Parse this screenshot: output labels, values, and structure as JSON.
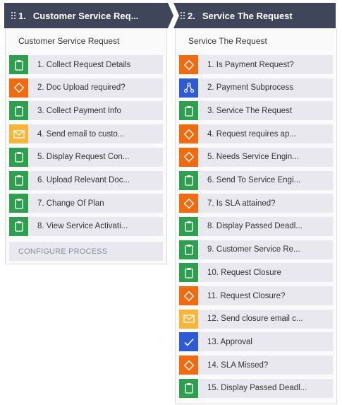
{
  "stages": [
    {
      "number": "1.",
      "header_title": "Customer Service Req...",
      "panel_title": "Customer Service Request",
      "configure_label": "CONFIGURE PROCESS",
      "steps": [
        {
          "label": "1.  Collect Request Details",
          "icon": "clipboard-icon",
          "color": "#2e9f4e"
        },
        {
          "label": "2.  Doc Upload required?",
          "icon": "diamond-icon",
          "color": "#f06a0f"
        },
        {
          "label": "3.  Collect Payment Info",
          "icon": "clipboard-icon",
          "color": "#2e9f4e"
        },
        {
          "label": "4.  Send email to custo...",
          "icon": "envelope-icon",
          "color": "#f7b53a"
        },
        {
          "label": "5.  Display Request Con...",
          "icon": "clipboard-icon",
          "color": "#2e9f4e"
        },
        {
          "label": "6.  Upload Relevant Doc...",
          "icon": "clipboard-icon",
          "color": "#2e9f4e"
        },
        {
          "label": "7.  Change Of Plan",
          "icon": "clipboard-icon",
          "color": "#2e9f4e"
        },
        {
          "label": "8.  View Service Activati...",
          "icon": "clipboard-icon",
          "color": "#2e9f4e"
        }
      ]
    },
    {
      "number": "2.",
      "header_title": "Service The Request",
      "panel_title": "Service The Request",
      "steps": [
        {
          "label": "1.  Is Payment Request?",
          "icon": "diamond-icon",
          "color": "#f06a0f"
        },
        {
          "label": "2.  Payment Subprocess",
          "icon": "subprocess-icon",
          "color": "#2f5ad6"
        },
        {
          "label": "3.  Service The Request",
          "icon": "clipboard-icon",
          "color": "#2e9f4e"
        },
        {
          "label": "4.  Request requires ap...",
          "icon": "diamond-icon",
          "color": "#f06a0f"
        },
        {
          "label": "5.  Needs Service Engin...",
          "icon": "diamond-icon",
          "color": "#f06a0f"
        },
        {
          "label": "6.  Send To Service Engi...",
          "icon": "clipboard-icon",
          "color": "#2e9f4e"
        },
        {
          "label": "7.  Is SLA attained?",
          "icon": "diamond-icon",
          "color": "#f06a0f"
        },
        {
          "label": "8.  Display Passed Deadl...",
          "icon": "clipboard-icon",
          "color": "#2e9f4e"
        },
        {
          "label": "9.  Customer Service Re...",
          "icon": "clipboard-icon",
          "color": "#2e9f4e"
        },
        {
          "label": "10.  Request Closure",
          "icon": "clipboard-icon",
          "color": "#2e9f4e"
        },
        {
          "label": "11.  Request Closure?",
          "icon": "diamond-icon",
          "color": "#f06a0f"
        },
        {
          "label": "12.  Send closure email c...",
          "icon": "envelope-icon",
          "color": "#f7b53a"
        },
        {
          "label": "13.  Approval",
          "icon": "checkmark-icon",
          "color": "#2f5ad6"
        },
        {
          "label": "14.  SLA Missed?",
          "icon": "diamond-icon",
          "color": "#f06a0f"
        },
        {
          "label": "15.  Display Passed Deadl...",
          "icon": "clipboard-icon",
          "color": "#2e9f4e"
        }
      ]
    }
  ]
}
